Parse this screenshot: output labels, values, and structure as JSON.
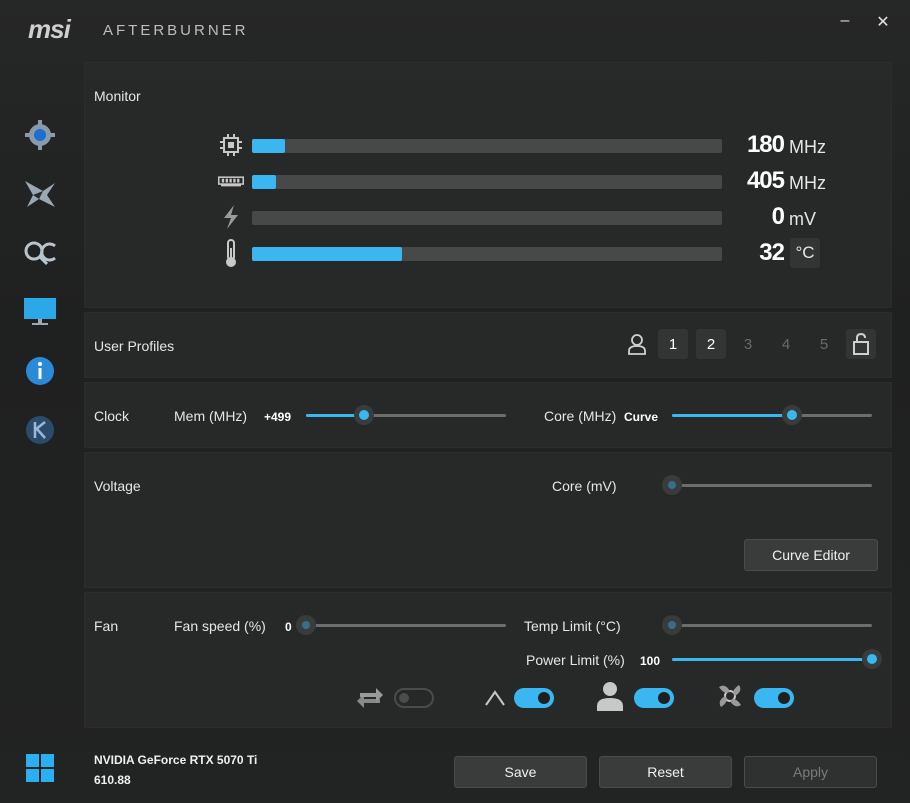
{
  "app": {
    "brand": "msi",
    "title": "AFTERBURNER",
    "minimize": "–",
    "close": "✕"
  },
  "monitor": {
    "title": "Monitor",
    "rows": [
      {
        "icon": "gpu-chip-icon",
        "value": "180",
        "unit": "MHz",
        "level": 0.07
      },
      {
        "icon": "memory-icon",
        "value": "405",
        "unit": "MHz",
        "level": 0.05
      },
      {
        "icon": "voltage-icon",
        "value": "0",
        "unit": "mV",
        "level": 0.0
      },
      {
        "icon": "temperature-icon",
        "value": "32",
        "unit": "°C",
        "level": 0.32
      }
    ]
  },
  "profiles": {
    "title": "User Profiles",
    "slots": [
      "1",
      "2",
      "3",
      "4",
      "5"
    ]
  },
  "clock": {
    "title": "Clock",
    "mem_label": "Mem (MHz)",
    "mem_value": "+499",
    "mem_level": 0.29,
    "core_label": "Core (MHz)",
    "core_value": "Curve",
    "core_level": 0.6
  },
  "voltage": {
    "title": "Voltage",
    "core_label": "Core (mV)",
    "core_level": 0.0,
    "curve_editor": "Curve Editor"
  },
  "fan": {
    "title": "Fan",
    "speed_label": "Fan speed (%)",
    "speed_value": "0",
    "speed_level": 0.0,
    "temp_label": "Temp Limit (°C)",
    "temp_level": 0.0,
    "power_label": "Power Limit (%)",
    "power_value": "100",
    "power_level": 1.0,
    "toggles": [
      {
        "icon": "fan-sync-icon",
        "on": false
      },
      {
        "icon": "auto-icon",
        "on": true
      },
      {
        "icon": "user-define-icon",
        "on": true
      },
      {
        "icon": "fan-mode-icon",
        "on": true
      }
    ]
  },
  "footer": {
    "gpu_name": "NVIDIA GeForce RTX 5070 Ti",
    "driver": "610.88",
    "save": "Save",
    "reset": "Reset",
    "apply": "Apply"
  },
  "colors": {
    "accent": "#3ab7f0",
    "background": "#1e1f1f"
  }
}
